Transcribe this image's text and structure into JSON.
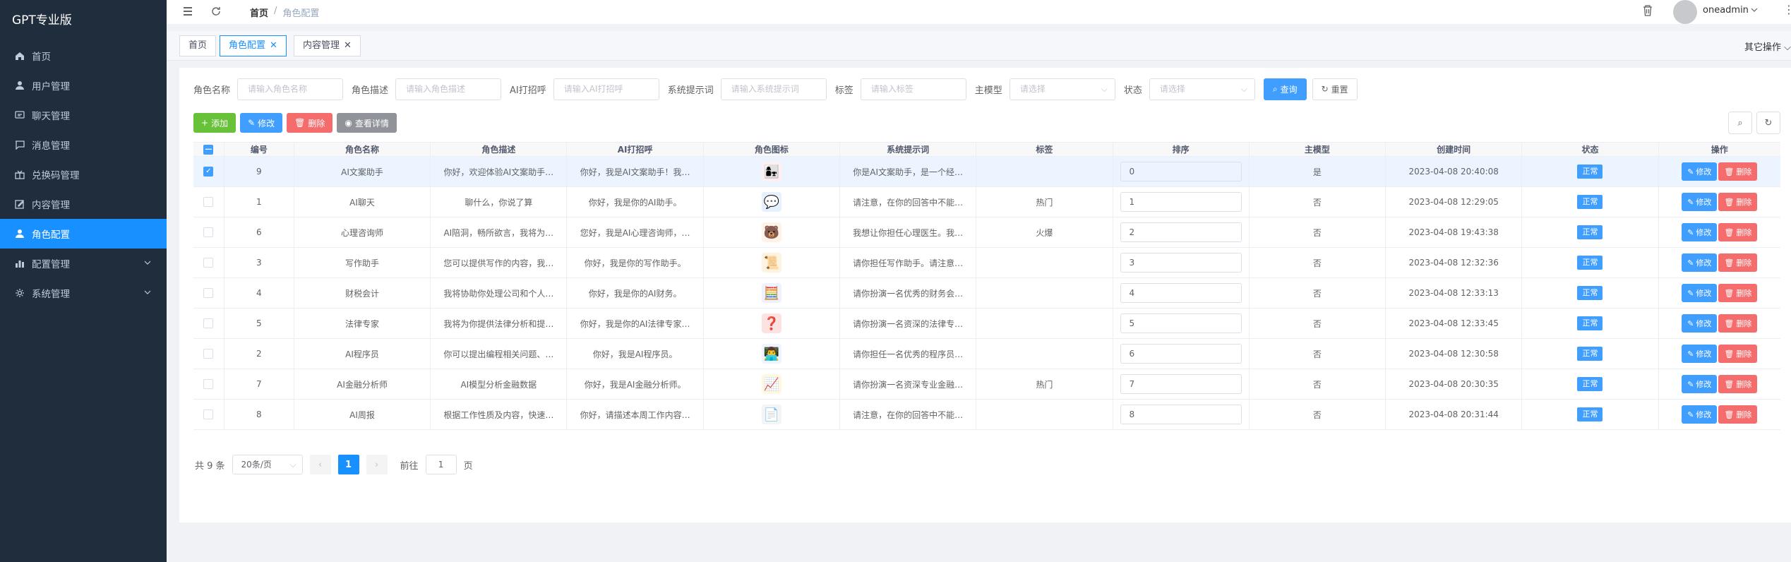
{
  "sidebar": {
    "logo": "GPT专业版",
    "items": [
      {
        "label": "首页",
        "icon": "home-icon"
      },
      {
        "label": "用户管理",
        "icon": "user-icon"
      },
      {
        "label": "聊天管理",
        "icon": "chat-icon"
      },
      {
        "label": "消息管理",
        "icon": "message-icon"
      },
      {
        "label": "兑换码管理",
        "icon": "gift-icon"
      },
      {
        "label": "内容管理",
        "icon": "edit-icon"
      },
      {
        "label": "角色配置",
        "icon": "user-icon",
        "active": true
      },
      {
        "label": "配置管理",
        "icon": "chart-icon",
        "expandable": true
      },
      {
        "label": "系统管理",
        "icon": "gear-icon",
        "expandable": true
      }
    ]
  },
  "header": {
    "breadcrumb": [
      "首页",
      "/",
      "角色配置"
    ],
    "username": "oneadmin"
  },
  "tags": {
    "items": [
      "首页",
      "角色配置",
      "内容管理"
    ],
    "other_ops": "其它操作"
  },
  "search": {
    "name_label": "角色名称",
    "name_placeholder": "请输入角色名称",
    "desc_label": "角色描述",
    "desc_placeholder": "请输入角色描述",
    "greet_label": "AI打招呼",
    "greet_placeholder": "请输入AI打招呼",
    "prompt_label": "系统提示词",
    "prompt_placeholder": "请输入系统提示词",
    "tag_label": "标签",
    "tag_placeholder": "请输入标签",
    "model_label": "主模型",
    "model_placeholder": "请选择",
    "status_label": "状态",
    "status_placeholder": "请选择",
    "query_label": "查询",
    "reset_label": "重置"
  },
  "toolbar": {
    "add": "添加",
    "edit": "修改",
    "delete": "删除",
    "detail": "查看详情"
  },
  "table": {
    "headers": [
      "编号",
      "角色名称",
      "角色描述",
      "AI打招呼",
      "角色图标",
      "系统提示词",
      "标签",
      "排序",
      "主模型",
      "创建时间",
      "状态",
      "操作"
    ],
    "rows": [
      {
        "id": "9",
        "name": "AI文案助手",
        "desc": "你好，欢迎体验AI文案助手…",
        "greet": "你好，我是AI文案助手！我…",
        "icon": "👩‍👧",
        "prompt": "你是AI文案助手，是一个经…",
        "tag": "",
        "sort": "0",
        "model": "是",
        "time": "2023-04-08 20:40:08",
        "status": "正常",
        "checked": true
      },
      {
        "id": "1",
        "name": "AI聊天",
        "desc": "聊什么，你说了算",
        "greet": "你好，我是你的AI助手。",
        "icon": "💬",
        "prompt": "请注意，在你的回答中不能…",
        "tag": "热门",
        "sort": "1",
        "model": "否",
        "time": "2023-04-08 12:29:05",
        "status": "正常"
      },
      {
        "id": "6",
        "name": "心理咨询师",
        "desc": "AI陪洞，畅所欲言，我将为…",
        "greet": "您好，我是AI心理咨询师，…",
        "icon": "🐻",
        "prompt": "我想让你担任心理医生。我…",
        "tag": "火爆",
        "sort": "2",
        "model": "否",
        "time": "2023-04-08 19:43:38",
        "status": "正常"
      },
      {
        "id": "3",
        "name": "写作助手",
        "desc": "您可以提供写作的内容，我…",
        "greet": "你好，我是你的写作助手。",
        "icon": "📜",
        "prompt": "请你担任写作助手。请注意…",
        "tag": "",
        "sort": "3",
        "model": "否",
        "time": "2023-04-08 12:32:36",
        "status": "正常"
      },
      {
        "id": "4",
        "name": "财税会计",
        "desc": "我将协助你处理公司和个人…",
        "greet": "你好，我是你的AI财务。",
        "icon": "🧮",
        "prompt": "请你扮演一名优秀的财务会…",
        "tag": "",
        "sort": "4",
        "model": "否",
        "time": "2023-04-08 12:33:13",
        "status": "正常"
      },
      {
        "id": "5",
        "name": "法律专家",
        "desc": "我将为你提供法律分析和提…",
        "greet": "你好，我是你的AI法律专家…",
        "icon": "❓",
        "prompt": "请你扮演一名资深的法律专…",
        "tag": "",
        "sort": "5",
        "model": "否",
        "time": "2023-04-08 12:33:45",
        "status": "正常"
      },
      {
        "id": "2",
        "name": "AI程序员",
        "desc": "你可以提出编程相关问题、…",
        "greet": "你好，我是AI程序员。",
        "icon": "👨‍💻",
        "prompt": "请你担任一名优秀的程序员…",
        "tag": "",
        "sort": "6",
        "model": "否",
        "time": "2023-04-08 12:30:58",
        "status": "正常"
      },
      {
        "id": "7",
        "name": "AI金融分析师",
        "desc": "AI模型分析金融数据",
        "greet": "你好，我是AI金融分析师。",
        "icon": "📈",
        "prompt": "请你扮演一名资深专业金融…",
        "tag": "热门",
        "sort": "7",
        "model": "否",
        "time": "2023-04-08 20:30:35",
        "status": "正常"
      },
      {
        "id": "8",
        "name": "AI周报",
        "desc": "根据工作性质及内容，快速…",
        "greet": "你好，请描述本周工作内容…",
        "icon": "📄",
        "prompt": "请注意，在你的回答中不能…",
        "tag": "",
        "sort": "8",
        "model": "否",
        "time": "2023-04-08 20:31:44",
        "status": "正常"
      }
    ],
    "edit_label": "修改",
    "delete_label": "删除"
  },
  "pagination": {
    "total": "共 9 条",
    "page_size": "20条/页",
    "current": "1",
    "goto_prefix": "前往",
    "goto_value": "1",
    "goto_suffix": "页"
  },
  "colors": {
    "sidebar_bg": "#1f2d3d",
    "accent": "#1890ff",
    "primary": "#409eff",
    "danger": "#f56c6c",
    "success": "#67c23a"
  }
}
